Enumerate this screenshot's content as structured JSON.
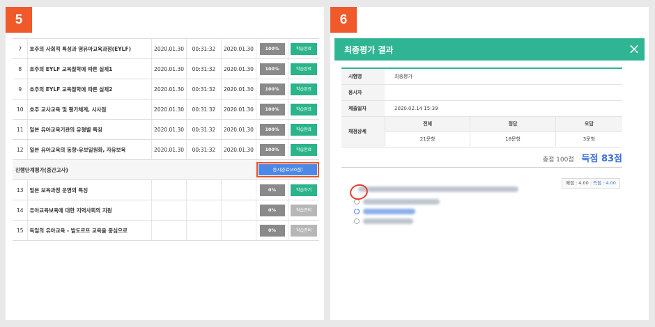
{
  "left": {
    "step": "5",
    "rows_a": [
      {
        "no": "7",
        "title": "호주의 사회적 특성과 영유아교육과정(EYLF)",
        "date": "2020.01.30",
        "time": "00:31:32",
        "end": "2020.01.30",
        "progress": "100%",
        "action": "학습완료"
      },
      {
        "no": "8",
        "title": "호주의 EYLF 교육철학에 따른 실제1",
        "date": "2020.01.30",
        "time": "00:31:32",
        "end": "2020.01.30",
        "progress": "100%",
        "action": "학습완료"
      },
      {
        "no": "9",
        "title": "호주의 EYLF 교육철학에 따른 실제2",
        "date": "2020.01.30",
        "time": "00:31:32",
        "end": "2020.01.30",
        "progress": "100%",
        "action": "학습완료"
      },
      {
        "no": "10",
        "title": "호주 교사교육 및 평가체계, 시사점",
        "date": "2020.01.30",
        "time": "00:31:32",
        "end": "2020.01.30",
        "progress": "100%",
        "action": "학습완료"
      },
      {
        "no": "11",
        "title": "일본 유아교육기관의 유형별 특징",
        "date": "2020.01.30",
        "time": "00:31:32",
        "end": "2020.01.30",
        "progress": "100%",
        "action": "학습완료"
      },
      {
        "no": "12",
        "title": "일본 유아교육의 동향-유보일원화, 자유보육",
        "date": "2020.01.30",
        "time": "00:31:32",
        "end": "2020.01.30",
        "progress": "100%",
        "action": "학습완료"
      }
    ],
    "section_label": "진행단계평가(중간고사)",
    "exam_button": "응시완료(40점)",
    "rows_b": [
      {
        "no": "13",
        "title": "일본 보육과정 운영의 특징",
        "date": "",
        "time": "",
        "end": "",
        "progress": "0%",
        "action": "학습하기"
      },
      {
        "no": "14",
        "title": "유아교육보육에 대한 지역사회의 지원",
        "date": "",
        "time": "",
        "end": "",
        "progress": "0%",
        "action": "학습준비"
      },
      {
        "no": "15",
        "title": "독일의 유아교육 - 발도르프 교육을 중심으로",
        "date": "",
        "time": "",
        "end": "",
        "progress": "0%",
        "action": "학습준비"
      }
    ]
  },
  "right": {
    "step": "6",
    "title": "최종평가 결과",
    "close_icon": "×",
    "labels": {
      "exam": "시험명",
      "taker": "응시자",
      "submitted": "제출일자",
      "detail": "채점상세"
    },
    "exam_name": "최종평가",
    "taker": "",
    "submitted": "2020.02.14 15:39",
    "detail_head": {
      "total": "전체",
      "correct": "정답",
      "wrong": "오답"
    },
    "detail_vals": {
      "total": "21문항",
      "correct": "18문항",
      "wrong": "3문항"
    },
    "score_total": "총점 100점",
    "score_gained": "득점 83점",
    "allot_label": "배점 : 4.00",
    "gain_label": "득점 : 4.00"
  },
  "colors": {
    "accent_green": "#2fb594",
    "step_orange": "#f05a2a",
    "blue": "#3b6fd6",
    "red": "#e53b3b"
  }
}
